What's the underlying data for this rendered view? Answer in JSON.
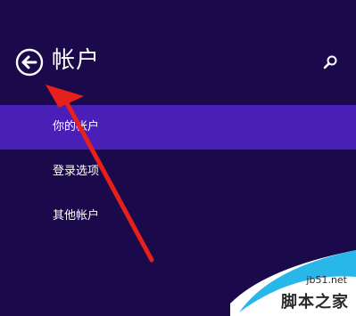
{
  "header": {
    "title": "帐户",
    "back_icon": "back-arrow-icon",
    "search_icon": "search-icon"
  },
  "nav": {
    "items": [
      {
        "label": "你的帐户",
        "selected": true
      },
      {
        "label": "登录选项",
        "selected": false
      },
      {
        "label": "其他帐户",
        "selected": false
      }
    ]
  },
  "watermark": {
    "url": "jb51.net",
    "name": "脚本之家"
  },
  "colors": {
    "background": "#1b0a4b",
    "selected": "#4a1fb8",
    "annotation_arrow": "#e8201c",
    "watermark_blue": "#29b6e8"
  }
}
